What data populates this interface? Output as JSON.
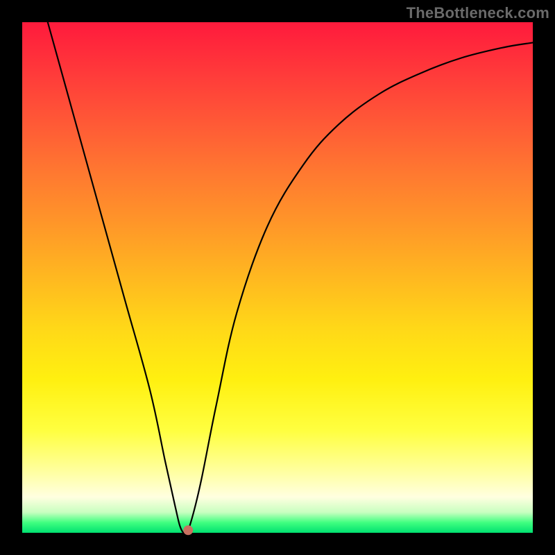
{
  "watermark": {
    "text": "TheBottleneck.com"
  },
  "chart_data": {
    "type": "line",
    "title": "",
    "xlabel": "",
    "ylabel": "",
    "xlim": [
      0,
      100
    ],
    "ylim": [
      0,
      100
    ],
    "grid": false,
    "legend": false,
    "series": [
      {
        "name": "curve",
        "x": [
          5,
          10,
          15,
          20,
          25,
          28,
          30,
          31,
          32,
          33,
          35,
          38,
          42,
          48,
          55,
          62,
          70,
          78,
          86,
          94,
          100
        ],
        "y": [
          100,
          82,
          64,
          46,
          28,
          14,
          5,
          1,
          0,
          2,
          10,
          25,
          43,
          60,
          72,
          80,
          86,
          90,
          93,
          95,
          96
        ]
      }
    ],
    "annotations": [
      {
        "name": "marker",
        "x": 32.5,
        "y": 0.5
      }
    ]
  }
}
